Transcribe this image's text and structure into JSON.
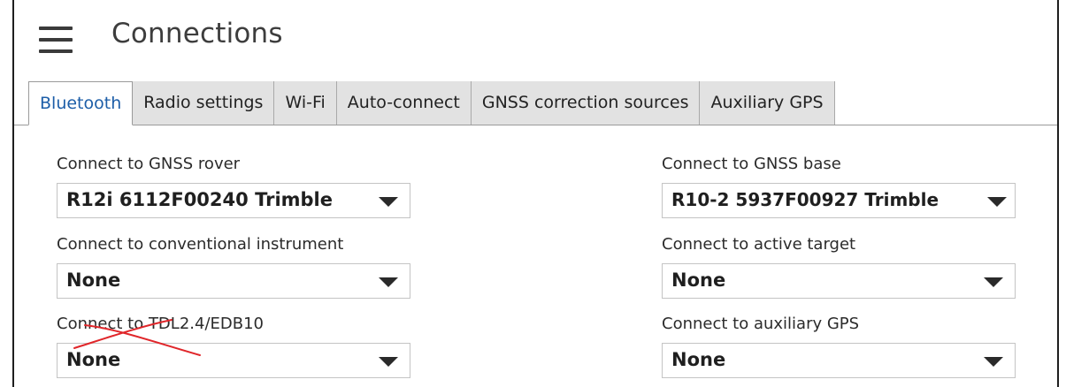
{
  "header": {
    "title": "Connections",
    "menu_icon": "hamburger-menu-icon"
  },
  "tabs": [
    {
      "label": "Bluetooth",
      "active": true
    },
    {
      "label": "Radio settings",
      "active": false
    },
    {
      "label": "Wi-Fi",
      "active": false
    },
    {
      "label": "Auto-connect",
      "active": false
    },
    {
      "label": "GNSS correction sources",
      "active": false
    },
    {
      "label": "Auxiliary GPS",
      "active": false
    }
  ],
  "fields": {
    "gnss_rover": {
      "label": "Connect to GNSS rover",
      "value": "R12i  6112F00240  Trimble"
    },
    "gnss_base": {
      "label": "Connect to GNSS base",
      "value": "R10-2  5937F00927  Trimble"
    },
    "conventional_instrument": {
      "label": "Connect to conventional instrument",
      "value": "None"
    },
    "active_target": {
      "label": "Connect to active target",
      "value": "None"
    },
    "tdl": {
      "label": "Connect to TDL2.4/EDB10",
      "value": "None"
    },
    "auxiliary_gps": {
      "label": "Connect to auxiliary GPS",
      "value": "None"
    }
  },
  "colors": {
    "active_tab_text": "#1d5ea8",
    "inactive_tab_bg": "#e2e2e2",
    "annotation_red": "#e0262a"
  }
}
